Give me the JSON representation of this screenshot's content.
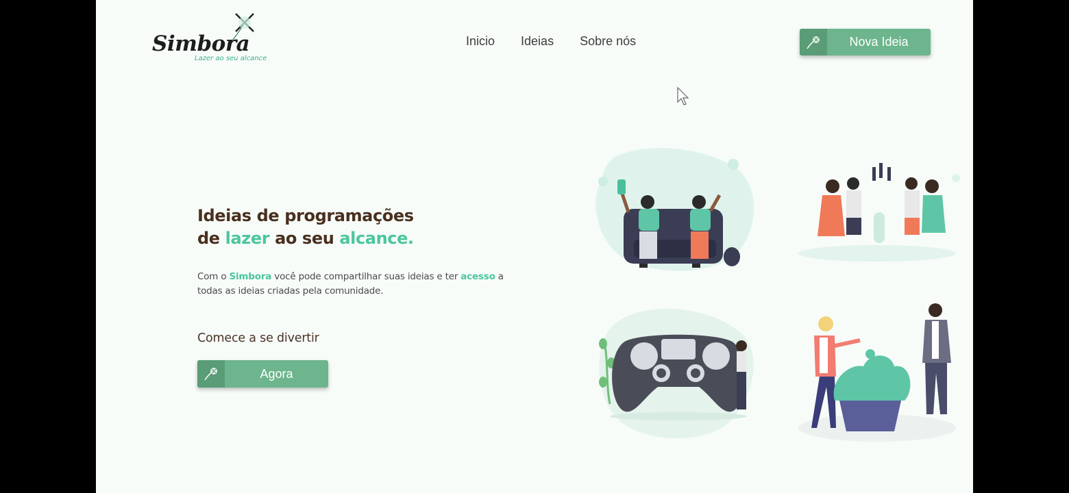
{
  "logo": {
    "wordmark": "Simbora",
    "tagline": "Lazer ao seu alcance"
  },
  "nav": {
    "items": [
      "Inicio",
      "Ideias",
      "Sobre nós"
    ]
  },
  "header_button": {
    "label": "Nova Ideia",
    "icon": "kite-icon"
  },
  "hero": {
    "title_line1": "Ideias de programações",
    "title_line2_a": "de ",
    "title_line2_b": "lazer",
    "title_line2_c": " ao seu ",
    "title_line2_d": "alcance.",
    "desc_a": "Com o ",
    "desc_b": "Simbora",
    "desc_c": " você pode compartilhar suas ideias e ter ",
    "desc_d": "acesso",
    "desc_e": " a todas as ideias criadas pela comunidade.",
    "cta_text": "Comece a se divertir",
    "cta_button": "Agora"
  },
  "colors": {
    "accent": "#4cc69d",
    "button": "#6db58c",
    "button_dark": "#599c76",
    "title": "#4a2f1e",
    "background": "#f7fcf9"
  }
}
